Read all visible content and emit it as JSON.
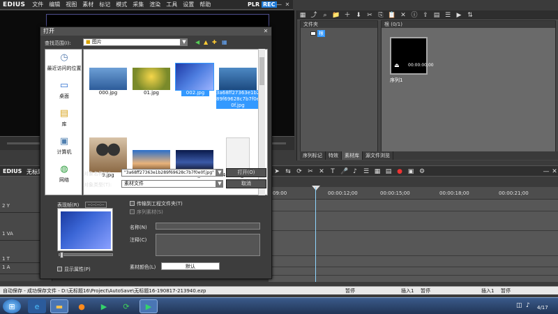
{
  "app": {
    "name": "EDIUS",
    "menu": [
      "文件",
      "编辑",
      "视图",
      "素材",
      "标记",
      "模式",
      "采集",
      "渲染",
      "工具",
      "设置",
      "帮助"
    ],
    "plr": "PLR",
    "rec": "REC"
  },
  "bin": {
    "folder_header": "文件夹",
    "root_folder": "根",
    "bin_header": "根 (0/1)",
    "sequence_name": "序列1",
    "thumb_timecode": "00:00:00;00",
    "tabs": [
      "序列标记",
      "特效",
      "素材库",
      "源文件浏览"
    ]
  },
  "timeline": {
    "project_name": "无标题",
    "ruler_labels": [
      "09:00",
      "00:00:12;00",
      "00:00:15;00",
      "00:00:18;00",
      "00:00:21;00"
    ],
    "tracks": [
      "2 Y",
      "1 VA",
      "1 A",
      "1 T",
      "1 A",
      "2 A"
    ]
  },
  "dialog": {
    "title": "打开",
    "look_in_label": "查找范围(I):",
    "look_in_value": "图片",
    "places": [
      {
        "label": "最近访问的位置",
        "icon": "recent-places-icon"
      },
      {
        "label": "桌面",
        "icon": "desktop-icon"
      },
      {
        "label": "库",
        "icon": "libraries-icon"
      },
      {
        "label": "计算机",
        "icon": "computer-icon"
      },
      {
        "label": "网络",
        "icon": "network-icon"
      }
    ],
    "files": [
      {
        "name": "000.jpg",
        "selected": false
      },
      {
        "name": "01.jpg",
        "selected": false
      },
      {
        "name": "002.jpg",
        "selected": true
      },
      {
        "name": "3a68ff27363e1b289f69628c7b7f0e0f.jpg",
        "display": "3a68ff27363e1b2\n89f69628c7b7f0e\n0f.jpg",
        "selected": true
      },
      {
        "name": "9.jpg",
        "selected": false
      },
      {
        "name": "370ace8df5322...",
        "selected": false
      },
      {
        "name": "1440x900_2d7e...",
        "selected": false
      },
      {
        "name": "1440x900_2d7e...",
        "selected": false
      }
    ],
    "object_name_label": "对象名称(N):",
    "object_name_value": "\"3a68ff27363e1b289f69628c7b7f0e0f.jpg\" \"0",
    "object_type_label": "对象类型(T):",
    "object_type_value": "素材文件",
    "open_button": "打开(O)",
    "cancel_button": "取消",
    "preview_label": "表现帧(R)",
    "preview_timecode": "--:--:--:--",
    "copy_to_project": "传输到工程文件夹(T)",
    "sequence_clip": "序列素材(S)",
    "name_label": "名称(N)",
    "comment_label": "注释(C)",
    "clip_color_label": "素材颜色(L)",
    "clip_color_value": "默认",
    "show_properties": "显示属性(P)"
  },
  "status": {
    "text": "自动保存 - 成功保存文件 - D:\\无标题16\\Project\\AutoSave\\无标题16-190817-213940.ezp",
    "pause1": "暂停",
    "insert1": "插入1",
    "pause2": "暂停",
    "insert2": "插入1",
    "pause3": "暂停"
  },
  "taskbar": {
    "clock": "4/17"
  },
  "colors": {
    "accent": "#3399ff",
    "rec": "#1d7ad9"
  }
}
